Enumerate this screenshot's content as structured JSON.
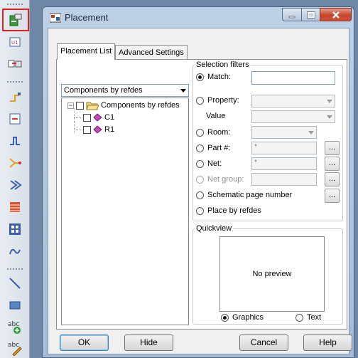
{
  "window": {
    "title": "Placement",
    "min_label": "▁",
    "max_label": "☐",
    "close_label": "✕"
  },
  "tabs": [
    {
      "label": "Placement List",
      "active": true
    },
    {
      "label": "Advanced Settings",
      "active": false
    }
  ],
  "list": {
    "dropdown_value": "Components by refdes",
    "tree_root": "Components by refdes",
    "tree_items": [
      "C1",
      "R1"
    ]
  },
  "filters": {
    "legend": "Selection filters",
    "match": {
      "label": "Match:",
      "value": ""
    },
    "property_label": "Property:",
    "value_label": "Value",
    "room_label": "Room:",
    "part_label": "Part #:",
    "part_placeholder": "*",
    "net_label": "Net:",
    "net_placeholder": "*",
    "netgroup_label": "Net group:",
    "schematic_label": "Schematic page number",
    "refdes_label": "Place by refdes",
    "ellipsis": "..."
  },
  "quickview": {
    "legend": "Quickview",
    "preview_text": "No preview",
    "graphics_label": "Graphics",
    "text_label": "Text"
  },
  "buttons": {
    "ok": "OK",
    "hide": "Hide",
    "cancel": "Cancel",
    "help": "Help"
  },
  "colors": {
    "accent_red": "#e02020",
    "titlebar": "#bdd0e6",
    "close": "#c7442c"
  }
}
